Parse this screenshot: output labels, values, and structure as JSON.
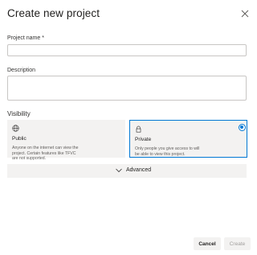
{
  "dialog": {
    "title": "Create new project",
    "close_icon": "close-icon"
  },
  "form": {
    "project_name_label": "Project name",
    "project_name_required": " *",
    "project_name_value": "",
    "description_label": "Description",
    "description_value": ""
  },
  "visibility": {
    "label": "Visibility",
    "selected": "private",
    "options": [
      {
        "id": "public",
        "icon": "globe-icon",
        "title": "Public",
        "description": "Anyone on the internet can view the project. Certain features like TFVC are not supported."
      },
      {
        "id": "private",
        "icon": "lock-icon",
        "title": "Private",
        "description": "Only people you give access to will be able to view this project."
      }
    ]
  },
  "advanced": {
    "label": "Advanced",
    "icon": "chevron-down-icon"
  },
  "footer": {
    "cancel_label": "Cancel",
    "create_label": "Create"
  },
  "colors": {
    "accent": "#0078d4",
    "card_bg": "#f3f2f1",
    "disabled_text": "#a19f9d"
  }
}
